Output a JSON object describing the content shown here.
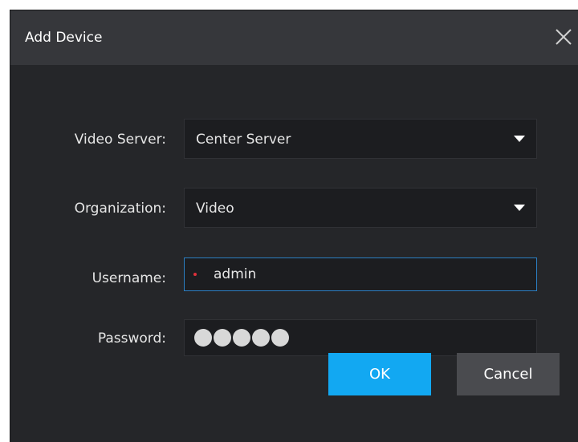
{
  "dialog": {
    "title": "Add Device",
    "close_icon": "close-icon"
  },
  "form": {
    "video_server": {
      "label": "Video Server:",
      "value": "Center Server"
    },
    "organization": {
      "label": "Organization:",
      "value": "Video"
    },
    "username": {
      "label": "Username:",
      "value": "admin",
      "required_marker_color": "#e0303a"
    },
    "password": {
      "label": "Password:",
      "masked_length": 5
    }
  },
  "buttons": {
    "ok_label": "OK",
    "cancel_label": "Cancel"
  },
  "colors": {
    "accent": "#12a8f2",
    "focus_border": "#2b7fc3"
  }
}
